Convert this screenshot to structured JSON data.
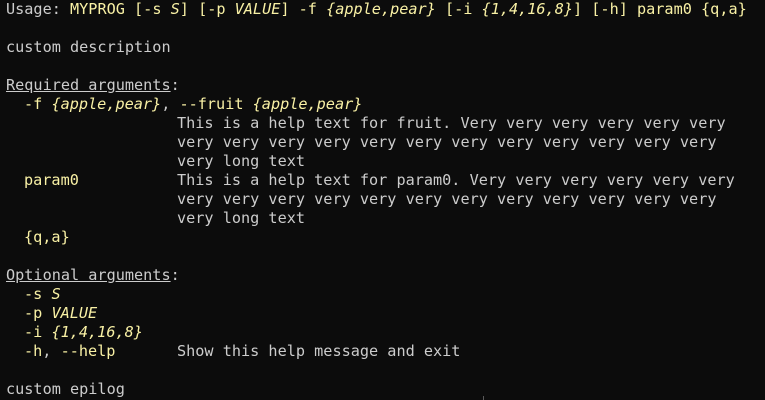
{
  "usage": {
    "label": "Usage: ",
    "prog": "MYPROG",
    "s_open": " [-s ",
    "s_meta": "S",
    "s_close": "]",
    "p_open": " [-p ",
    "p_meta": "VALUE",
    "p_close": "]",
    "f_flag": " -f ",
    "f_meta": "{apple,pear}",
    "i_open": " [-i ",
    "i_meta": "{1,4,16,8}",
    "i_close": "]",
    "h_part": " [-h]",
    "pos_part": " param0 {q,a}"
  },
  "description": "custom description",
  "required": {
    "heading": "Required arguments",
    "colon": ":",
    "fruit_short": "-f",
    "fruit_short_meta": "{apple,pear}",
    "fruit_sep": ", ",
    "fruit_long": "--fruit",
    "fruit_long_meta": "{apple,pear}",
    "fruit_help": [
      "This is a help text for fruit. Very very very very very very",
      "very very very very very very very very very very very very",
      "very long text"
    ],
    "param0_name": "param0",
    "param0_help": [
      "This is a help text for param0. Very very very very very very",
      "very very very very very very very very very very very very",
      "very long text"
    ],
    "choice_meta": "{q,a}"
  },
  "optional": {
    "heading": "Optional arguments",
    "colon": ":",
    "s_flag": "-s",
    "s_meta": "S",
    "p_flag": "-p",
    "p_meta": "VALUE",
    "i_flag": "-i",
    "i_meta": "{1,4,16,8}",
    "h_short": "-h",
    "h_sep": ", ",
    "h_long": "--help",
    "h_help": "Show this help message and exit"
  },
  "epilog": "custom epilog",
  "colors": {
    "background": "#0c0c0c",
    "text": "#cccccc",
    "highlight": "#f9f1a5"
  }
}
